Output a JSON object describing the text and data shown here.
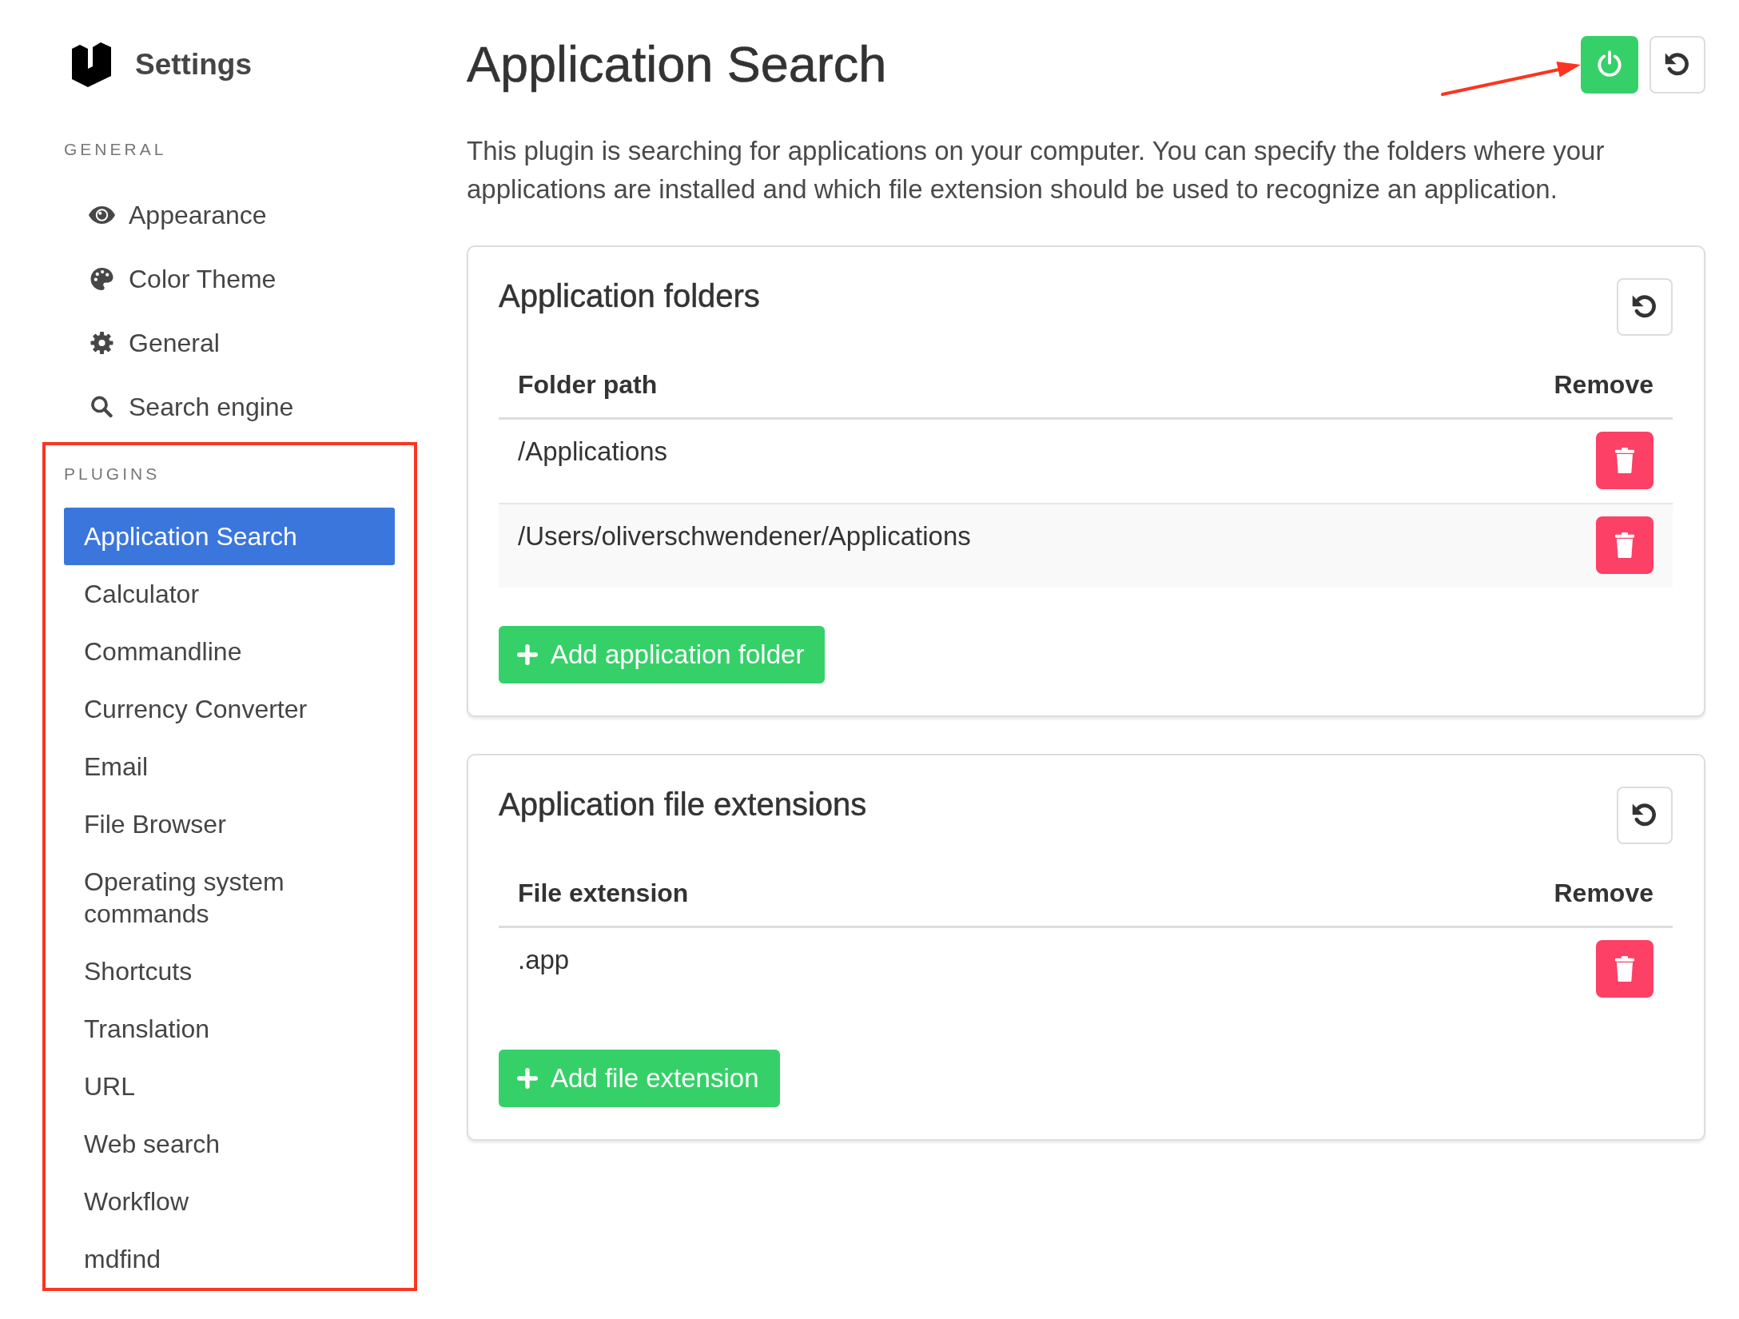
{
  "sidebar": {
    "title": "Settings",
    "sections": [
      {
        "heading": "GENERAL",
        "highlighted": false,
        "items": [
          {
            "label": "Appearance",
            "selected": false
          },
          {
            "label": "Color Theme",
            "selected": false
          },
          {
            "label": "General",
            "selected": false
          },
          {
            "label": "Search engine",
            "selected": false
          }
        ]
      },
      {
        "heading": "PLUGINS",
        "highlighted": true,
        "items": [
          {
            "label": "Application Search",
            "selected": true
          },
          {
            "label": "Calculator",
            "selected": false
          },
          {
            "label": "Commandline",
            "selected": false
          },
          {
            "label": "Currency Converter",
            "selected": false
          },
          {
            "label": "Email",
            "selected": false
          },
          {
            "label": "File Browser",
            "selected": false
          },
          {
            "label": "Operating system commands",
            "selected": false
          },
          {
            "label": "Shortcuts",
            "selected": false
          },
          {
            "label": "Translation",
            "selected": false
          },
          {
            "label": "URL",
            "selected": false
          },
          {
            "label": "Web search",
            "selected": false
          },
          {
            "label": "Workflow",
            "selected": false
          },
          {
            "label": "mdfind",
            "selected": false
          }
        ]
      }
    ]
  },
  "page": {
    "title": "Application Search",
    "power_button": {
      "on": true,
      "highlighted": true
    },
    "description": "This plugin is searching for applications on your computer. You can specify the folders where your applications are installed and which file extension should be used to recognize an application.",
    "cards": [
      {
        "title": "Application folders",
        "columns": [
          "Folder path",
          "Remove"
        ],
        "rows": [
          "/Applications",
          "/Users/oliverschwendener/Applications"
        ],
        "add_button": "Add application folder"
      },
      {
        "title": "Application file extensions",
        "columns": [
          "File extension",
          "Remove"
        ],
        "rows": [
          ".app"
        ],
        "add_button": "Add file extension"
      }
    ]
  }
}
